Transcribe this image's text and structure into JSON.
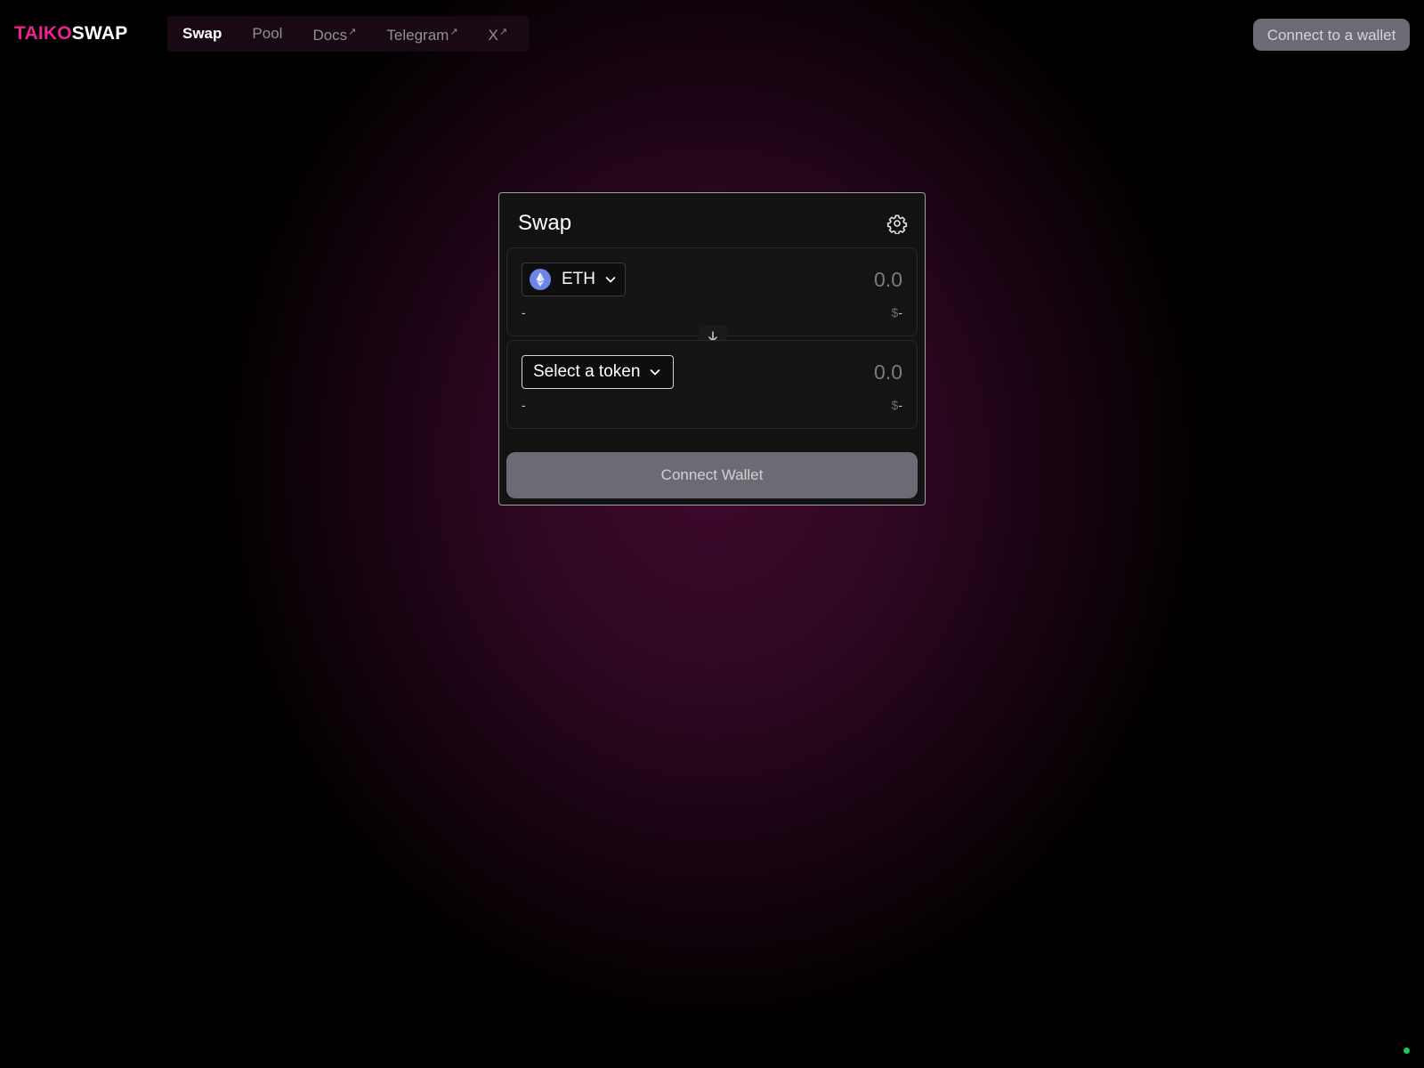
{
  "header": {
    "logo_part1": "TAIKO",
    "logo_part2": "SWAP",
    "nav": [
      {
        "label": "Swap",
        "active": true,
        "external": false
      },
      {
        "label": "Pool",
        "active": false,
        "external": false
      },
      {
        "label": "Docs",
        "active": false,
        "external": true
      },
      {
        "label": "Telegram",
        "active": false,
        "external": true
      },
      {
        "label": "X",
        "active": false,
        "external": true
      }
    ],
    "connect_label": "Connect to a wallet"
  },
  "swap": {
    "title": "Swap",
    "from": {
      "token": "ETH",
      "token_icon": "ethereum-icon",
      "amount_placeholder": "0.0",
      "balance": "-",
      "usd_symbol": "$",
      "usd_value": "-"
    },
    "to": {
      "token": "Select a token",
      "amount_placeholder": "0.0",
      "balance": "-",
      "usd_symbol": "$",
      "usd_value": "-"
    },
    "flip_icon": "arrow-down-icon",
    "connect_label": "Connect Wallet"
  },
  "colors": {
    "brand_pink": "#e8258f",
    "status_green": "#22c55e",
    "button_gray": "#6b6b73",
    "eth_blue": "#6c86e8"
  }
}
